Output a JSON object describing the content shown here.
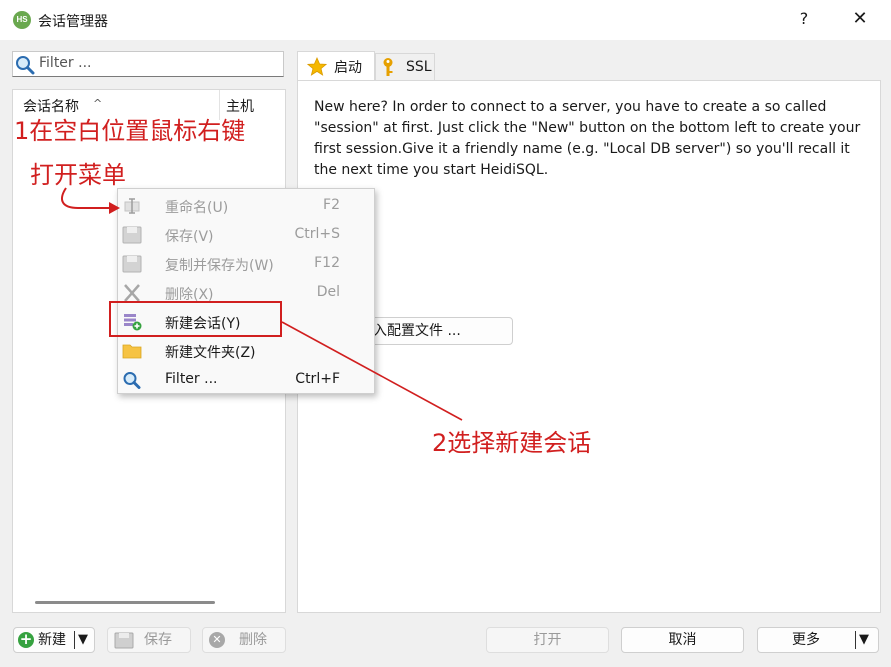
{
  "window": {
    "title": "会话管理器",
    "logo_text": "HS",
    "help_glyph": "?",
    "close_glyph": "✕"
  },
  "filter": {
    "placeholder": "Filter ..."
  },
  "tree": {
    "columns": [
      "会话名称",
      "主机"
    ],
    "sort_glyph": "^"
  },
  "tabs": [
    {
      "label": "启动",
      "icon": "star-icon",
      "active": true
    },
    {
      "label": "SSL",
      "icon": "key-icon",
      "active": false
    }
  ],
  "welcome": "New here? In order to connect to a server, you have to create a so called \"session\" at first. Just click the \"New\" button on the bottom left to create your first session.Give it a friendly name (e.g. \"Local DB server\") so you'll recall it the next time you start HeidiSQL.",
  "import_button": {
    "label": "入配置文件 ..."
  },
  "context_menu": [
    {
      "label": "重命名(U)",
      "shortcut": "F2",
      "icon": "rename-cursor-icon",
      "enabled": false
    },
    {
      "label": "保存(V)",
      "shortcut": "Ctrl+S",
      "icon": "save-icon",
      "enabled": false
    },
    {
      "label": "复制并保存为(W)",
      "shortcut": "F12",
      "icon": "save-copy-icon",
      "enabled": false
    },
    {
      "label": "删除(X)",
      "shortcut": "Del",
      "icon": "delete-x-icon",
      "enabled": false
    },
    {
      "label": "新建会话(Y)",
      "shortcut": "",
      "icon": "new-session-icon",
      "enabled": true
    },
    {
      "label": "新建文件夹(Z)",
      "shortcut": "",
      "icon": "folder-icon",
      "enabled": true
    },
    {
      "label": "Filter ...",
      "shortcut": "Ctrl+F",
      "icon": "magnifier-icon",
      "enabled": true
    }
  ],
  "buttons": {
    "new": "新建",
    "save": "保存",
    "delete": "删除",
    "open": "打开",
    "cancel": "取消",
    "more": "更多",
    "dropdown_glyph": "▼"
  },
  "annotations": {
    "step1": "1在空白位置鼠标右键",
    "step1b": "打开菜单",
    "step2": "2选择新建会话"
  },
  "colors": {
    "annotation": "#d11f1f",
    "accent_star": "#f5b800",
    "key": "#e6a000",
    "folder": "#f6c343",
    "new_green": "#36a240"
  }
}
